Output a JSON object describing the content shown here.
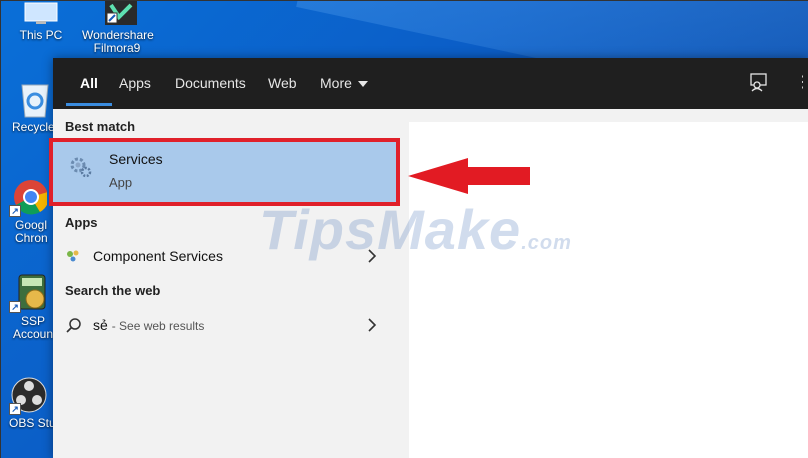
{
  "desktop": {
    "icons": [
      {
        "label": "This PC",
        "name": "this-pc"
      },
      {
        "label": "Wondershare Filmora9",
        "name": "wondershare-filmora9"
      },
      {
        "label": "Recycle",
        "name": "recycle-bin"
      },
      {
        "label": "Googl Chron",
        "name": "google-chrome"
      },
      {
        "label": "SSP Accoun",
        "name": "ssp-accounting"
      },
      {
        "label": "OBS Stu",
        "name": "obs-studio"
      }
    ]
  },
  "search": {
    "tabs": [
      "All",
      "Apps",
      "Documents",
      "Web",
      "More"
    ],
    "active_tab": "All",
    "best_match_heading": "Best match",
    "best_match": {
      "title": "Services",
      "type": "App"
    },
    "apps_heading": "Apps",
    "apps": [
      {
        "label": "Component Services"
      }
    ],
    "web_heading": "Search the web",
    "web_query": "sẻ",
    "web_suffix": "- See web results"
  },
  "watermark": {
    "text": "TipsMake",
    "suffix": ".com"
  },
  "colors": {
    "accent": "#3b8de0",
    "highlight_border": "#e0202a",
    "selected_bg": "#a9c9eb",
    "topbar": "#1f1f1f"
  },
  "icons": {
    "feedback": "feedback-icon",
    "services": "gear-services-icon",
    "component": "component-services-icon",
    "search": "search-icon",
    "chevron": "chevron-right-icon"
  }
}
